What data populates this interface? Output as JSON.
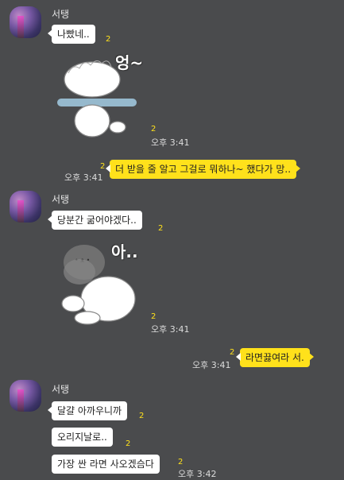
{
  "sender": {
    "name": "서탱"
  },
  "group1": {
    "msg1": "나빴네..",
    "msg1_unread": "2",
    "sticker_text": "엉~",
    "sticker_unread": "2",
    "sticker_time": "오후 3:41"
  },
  "me1": {
    "text": "더 받을 줄 알고 그걸로 뭐하나~ 했다가 망..",
    "unread": "2",
    "time": "오후 3:41"
  },
  "group2": {
    "msg1": "당분간 굶어야겠다..",
    "msg1_unread": "2",
    "sticker_text": "아..",
    "sticker_unread": "2",
    "sticker_time": "오후 3:41"
  },
  "me2": {
    "text": "라면끓여라 서.",
    "unread": "2",
    "time": "오후 3:41"
  },
  "group3": {
    "msg1": "달걀 아까우니까",
    "msg1_unread": "2",
    "msg2": "오리지날로..",
    "msg2_unread": "2",
    "msg3": "가장 싼 라면 사오겠슴다",
    "msg3_unread": "2",
    "msg3_time": "오후 3:42"
  },
  "colors": {
    "background": "#4a4b4d",
    "my_bubble": "#ffe11b",
    "their_bubble": "#ffffff",
    "unread": "#ffe11b"
  }
}
